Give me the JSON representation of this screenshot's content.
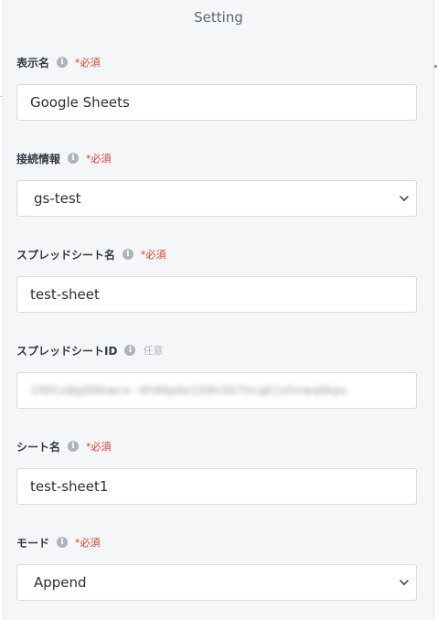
{
  "panel": {
    "title": "Setting"
  },
  "fields": [
    {
      "label": "表示名",
      "tag": "*必須",
      "value": "Google Sheets"
    },
    {
      "label": "接続情報",
      "tag": "*必須",
      "value": "gs-test"
    },
    {
      "label": "スプレッドシート名",
      "tag": "*必須",
      "value": "test-sheet"
    },
    {
      "label": "スプレッドシートID",
      "tag": "任意",
      "value": "1f6fcx8pJ99kwcx--4h90p6e1S9h3G7hcqK1xhnwq9kps"
    },
    {
      "label": "シート名",
      "tag": "*必須",
      "value": "test-sheet1"
    },
    {
      "label": "モード",
      "tag": "*必須",
      "value": "Append"
    }
  ],
  "icons": {
    "info": "info-icon",
    "dropdown": "chevron-down-icon"
  },
  "colors": {
    "required": "#d8412f",
    "optional": "#b3b8bd",
    "panel_bg": "#f4f6f8"
  }
}
